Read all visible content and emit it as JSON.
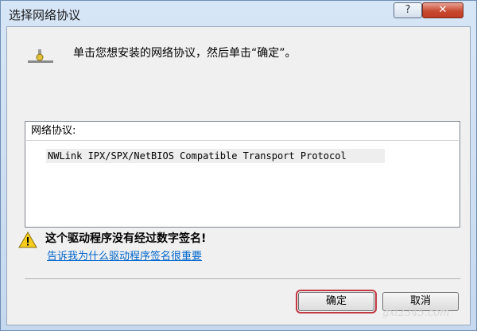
{
  "window": {
    "title": "选择网络协议"
  },
  "titlebar": {
    "help_label": "?",
    "close_label": "✕"
  },
  "instruction": "单击您想安装的网络协议，然后单击“确定”。",
  "protocol_list": {
    "header": "网络协议:",
    "items": [
      "NWLink IPX/SPX/NetBIOS Compatible Transport Protocol"
    ]
  },
  "warning": {
    "text": "这个驱动程序没有经过数字签名!",
    "link": "告诉我为什么驱动程序签名很重要"
  },
  "buttons": {
    "ok": "确定",
    "cancel": "取消"
  },
  "watermark": "gxl2345.com",
  "colors": {
    "link": "#0066cc",
    "close": "#c84a31",
    "ok_outline": "#c23a44"
  },
  "icons": {
    "network": "network-protocol-icon",
    "warning": "warning-icon"
  }
}
